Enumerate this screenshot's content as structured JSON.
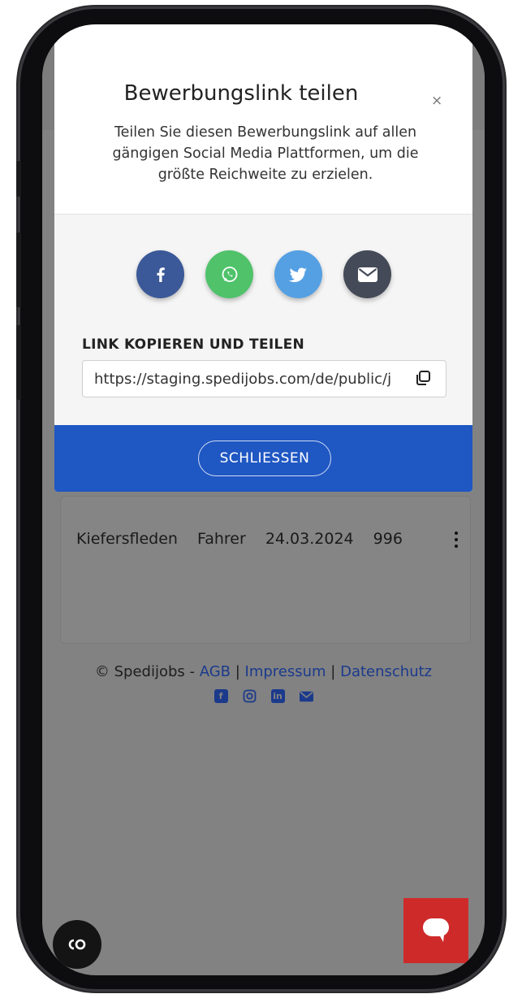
{
  "modal": {
    "title": "Bewerbungslink teilen",
    "close_symbol": "×",
    "description": "Teilen Sie diesen Bewerbungslink auf allen gängigen Social Media Plattformen, um die größte Reichweite zu erzielen.",
    "share_icons": [
      "facebook-icon",
      "whatsapp-icon",
      "twitter-icon",
      "email-icon"
    ],
    "share_colors": {
      "facebook": "#3b5998",
      "whatsapp": "#4fc26a",
      "twitter": "#55a0e3",
      "email": "#444a57"
    },
    "copy_label": "LINK KOPIEREN UND TEILEN",
    "link_value": "https://staging.spedijobs.com/de/public/j",
    "close_button": "SCHLIESSEN"
  },
  "background": {
    "card": {
      "location": "Kiefersfleden",
      "position": "Fahrer",
      "date": "24.03.2024",
      "count": "996"
    },
    "footer": {
      "copyright": "© Spedijobs - ",
      "agb": "AGB",
      "sep": " | ",
      "impressum": "Impressum",
      "datenschutz": "Datenschutz",
      "social_icons": [
        "facebook-icon",
        "instagram-icon",
        "linkedin-icon",
        "email-icon"
      ]
    }
  },
  "colors": {
    "accent_blue": "#1f57c3",
    "chat_red": "#cf2a2a",
    "overlay_gray": "#828282"
  }
}
